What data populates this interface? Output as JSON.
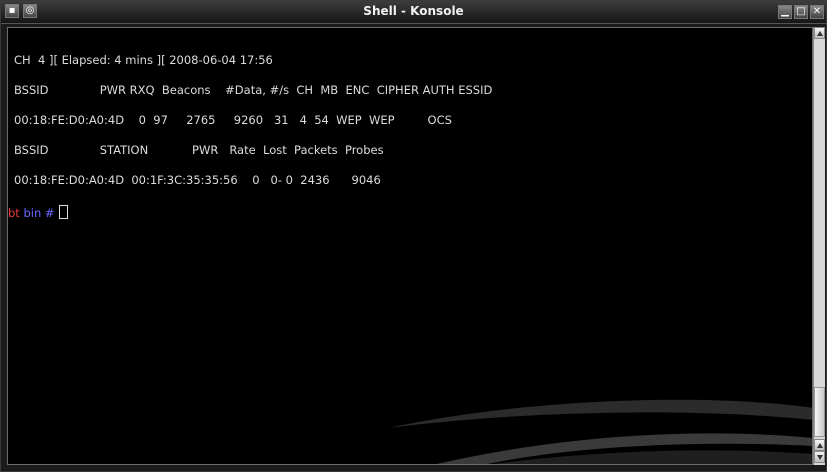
{
  "window": {
    "title": "Shell - Konsole",
    "controls": {
      "minimize": "▁",
      "maximize": "□",
      "close": "✕"
    }
  },
  "terminal": {
    "lines": [
      "CH  4 ][ Elapsed: 4 mins ][ 2008-06-04 17:56",
      "BSSID              PWR RXQ  Beacons    #Data, #/s  CH  MB  ENC  CIPHER AUTH ESSID",
      "00:18:FE:D0:A0:4D    0  97     2765     9260   31   4  54  WEP  WEP         OCS",
      "BSSID              STATION            PWR   Rate  Lost  Packets  Probes",
      "00:18:FE:D0:A0:4D  00:1F:3C:35:35:56    0   0- 0  2436      9046"
    ],
    "prompt": {
      "user": "bt",
      "dir": "bin",
      "symbol": "#"
    }
  },
  "colors": {
    "prompt_user": "#e83a3a",
    "prompt_dir": "#6a6aff",
    "text": "#dcdcdc",
    "background": "#000000"
  }
}
